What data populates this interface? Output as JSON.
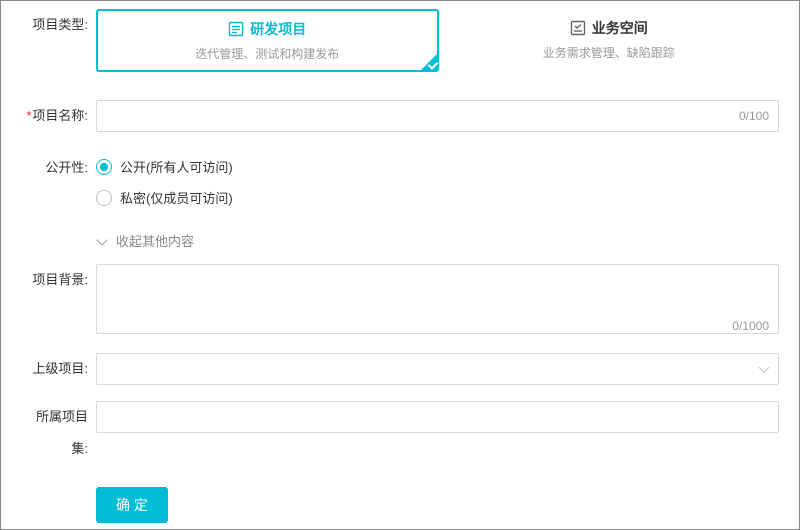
{
  "labels": {
    "project_type": "项目类型:",
    "project_name": "项目名称:",
    "visibility": "公开性:",
    "collapse": "收起其他内容",
    "background": "项目背景:",
    "parent_project": "上级项目:",
    "project_set": "所属项目集:"
  },
  "required_star": "*",
  "type_cards": {
    "dev": {
      "title": "研发项目",
      "desc": "迭代管理、测试和构建发布"
    },
    "biz": {
      "title": "业务空间",
      "desc": "业务需求管理、缺陷跟踪"
    }
  },
  "name": {
    "value": "",
    "counter": "0/100"
  },
  "visibility": {
    "public": "公开(所有人可访问)",
    "private": "私密(仅成员可访问)"
  },
  "background": {
    "value": "",
    "counter": "0/1000"
  },
  "parent_project": {
    "value": ""
  },
  "project_set": {
    "value": ""
  },
  "buttons": {
    "confirm": "确 定"
  }
}
